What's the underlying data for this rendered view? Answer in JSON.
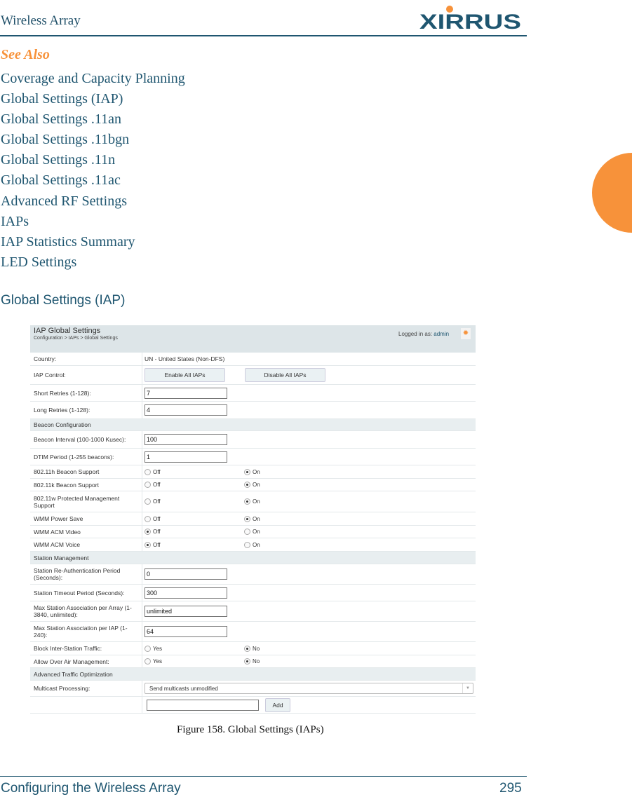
{
  "header": {
    "title": "Wireless Array",
    "logo_text": "XIRRUS"
  },
  "see_also": {
    "heading": "See Also",
    "links": [
      "Coverage and Capacity Planning",
      "Global Settings (IAP)",
      "Global Settings .11an",
      "Global Settings .11bgn",
      "Global Settings .11n",
      "Global Settings .11ac",
      "Advanced RF Settings",
      "IAPs",
      "IAP Statistics Summary",
      "LED Settings"
    ]
  },
  "section_title": "Global Settings (IAP)",
  "screenshot": {
    "title": "IAP Global Settings",
    "breadcrumb": "Configuration > IAPs > Global Settings",
    "login_prefix": "Logged in as:",
    "login_user": "admin",
    "rows": [
      {
        "type": "text",
        "label": "Country:",
        "value": "UN - United States (Non-DFS)"
      },
      {
        "type": "buttons",
        "label": "IAP Control:",
        "buttons": [
          "Enable All IAPs",
          "Disable All IAPs"
        ]
      },
      {
        "type": "input",
        "label": "Short Retries (1-128):",
        "value": "7"
      },
      {
        "type": "input",
        "label": "Long Retries (1-128):",
        "value": "4"
      },
      {
        "type": "section",
        "label": "Beacon Configuration"
      },
      {
        "type": "input",
        "label": "Beacon Interval (100-1000 Kusec):",
        "value": "100"
      },
      {
        "type": "input",
        "label": "DTIM Period (1-255 beacons):",
        "value": "1"
      },
      {
        "type": "radio",
        "label": "802.11h Beacon Support",
        "options": [
          "Off",
          "On"
        ],
        "selected": "On"
      },
      {
        "type": "radio",
        "label": "802.11k Beacon Support",
        "options": [
          "Off",
          "On"
        ],
        "selected": "On"
      },
      {
        "type": "radio",
        "label": "802.11w Protected Management Support",
        "options": [
          "Off",
          "On"
        ],
        "selected": "On"
      },
      {
        "type": "radio",
        "label": "WMM Power Save",
        "options": [
          "Off",
          "On"
        ],
        "selected": "On"
      },
      {
        "type": "radio",
        "label": "WMM ACM Video",
        "options": [
          "Off",
          "On"
        ],
        "selected": "Off"
      },
      {
        "type": "radio",
        "label": "WMM ACM Voice",
        "options": [
          "Off",
          "On"
        ],
        "selected": "Off"
      },
      {
        "type": "section",
        "label": "Station Management"
      },
      {
        "type": "input",
        "label": "Station Re-Authentication Period (Seconds):",
        "value": "0"
      },
      {
        "type": "input",
        "label": "Station Timeout Period (Seconds):",
        "value": "300"
      },
      {
        "type": "input",
        "label": "Max Station Association per Array (1-3840, unlimited):",
        "value": "unlimited"
      },
      {
        "type": "input",
        "label": "Max Station Association per IAP (1-240):",
        "value": "64"
      },
      {
        "type": "radio",
        "label": "Block Inter-Station Traffic:",
        "options": [
          "Yes",
          "No"
        ],
        "selected": "No"
      },
      {
        "type": "radio",
        "label": "Allow Over Air Management:",
        "options": [
          "Yes",
          "No"
        ],
        "selected": "No"
      },
      {
        "type": "section",
        "label": "Advanced Traffic Optimization"
      },
      {
        "type": "select",
        "label": "Multicast Processing:",
        "value": "Send multicasts unmodified"
      },
      {
        "type": "add",
        "label": "",
        "value": "",
        "button": "Add"
      }
    ]
  },
  "caption": "Figure 158. Global Settings (IAPs)",
  "footer": {
    "left": "Configuring the Wireless Array",
    "page": "295"
  },
  "colors": {
    "brand": "#1f5670",
    "accent": "#f7923a"
  }
}
